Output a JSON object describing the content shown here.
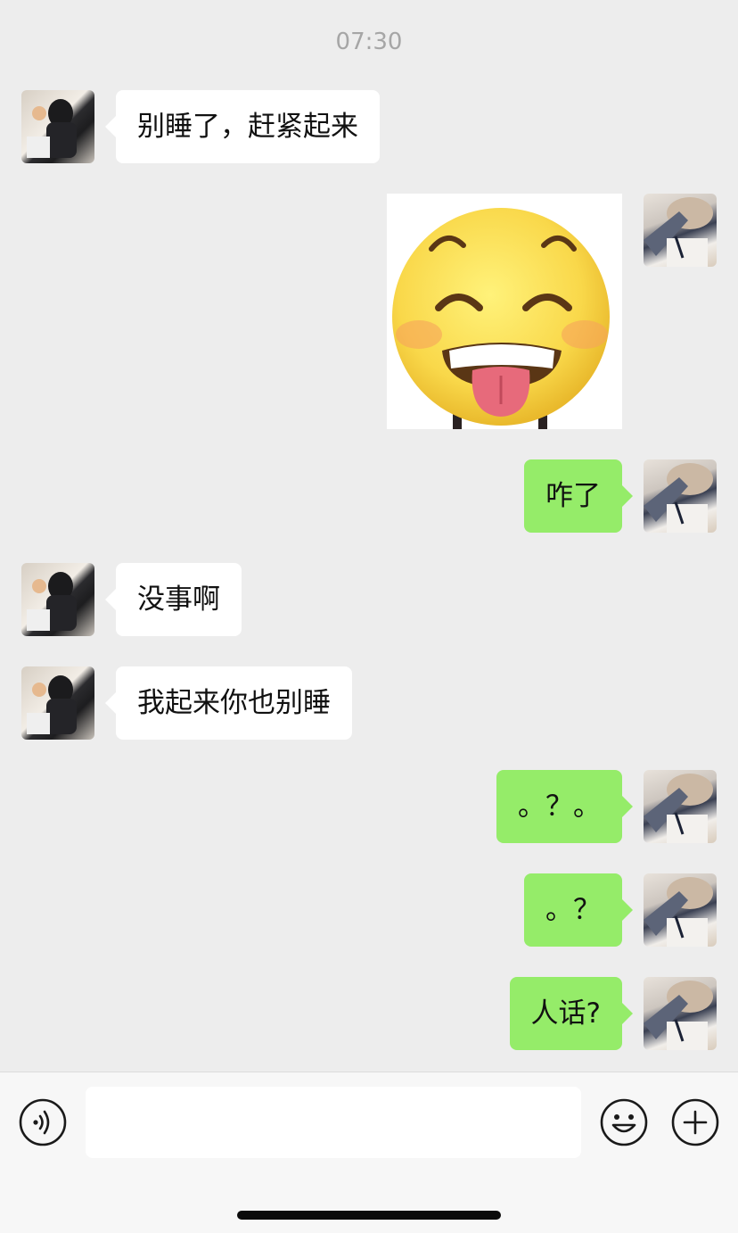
{
  "chat": {
    "timestamp": "07:30",
    "messages": [
      {
        "from": "friend",
        "text": "别睡了，赶紧起来"
      },
      {
        "from": "self",
        "type": "sticker",
        "sticker": "grinning-tongue-out-emoji"
      },
      {
        "from": "self",
        "text": "咋了"
      },
      {
        "from": "friend",
        "text": "没事啊"
      },
      {
        "from": "friend",
        "text": "我起来你也别睡"
      },
      {
        "from": "self",
        "text": "。？。"
      },
      {
        "from": "self",
        "text": "。？"
      },
      {
        "from": "self",
        "text": "人话?"
      }
    ]
  },
  "input_bar": {
    "message_value": "",
    "voice_icon": "voice-input-icon",
    "emoji_icon": "emoji-icon",
    "plus_icon": "more-plus-icon"
  },
  "colors": {
    "background": "#ededed",
    "outgoing_bubble": "#95ec69",
    "incoming_bubble": "#ffffff",
    "timestamp_text": "#a6a6a6"
  }
}
